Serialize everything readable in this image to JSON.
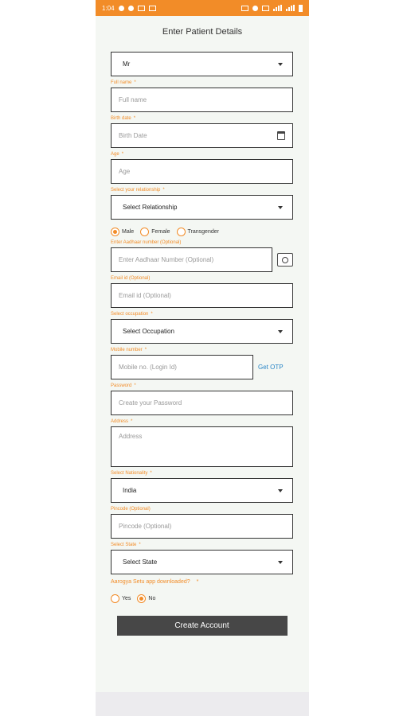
{
  "status_bar": {
    "time": "1:04"
  },
  "header": {
    "title": "Enter Patient Details"
  },
  "form": {
    "salutation": {
      "value": "Mr"
    },
    "full_name": {
      "label": "Full name",
      "placeholder": "Full name"
    },
    "birth_date": {
      "label": "Birth date",
      "placeholder": "Birth Date"
    },
    "age": {
      "label": "Age",
      "placeholder": "Age"
    },
    "relationship": {
      "label": "Select your relationship",
      "value": "Select Relationship"
    },
    "gender": {
      "options": [
        "Male",
        "Female",
        "Transgender"
      ],
      "selected": "Male"
    },
    "aadhaar": {
      "label": "Enter Aadhaar number (Optional)",
      "placeholder": "Enter Aadhaar Number (Optional)"
    },
    "email": {
      "label": "Email id (Optional)",
      "placeholder": "Email id (Optional)"
    },
    "occupation": {
      "label": "Select occupation",
      "value": "Select Occupation"
    },
    "mobile": {
      "label": "Mobile number",
      "placeholder": "Mobile no. (Login Id)",
      "otp_label": "Get OTP"
    },
    "password": {
      "label": "Password",
      "placeholder": "Create your Password"
    },
    "address": {
      "label": "Address",
      "placeholder": "Address"
    },
    "nationality": {
      "label": "Select Nationality",
      "value": "India"
    },
    "pincode": {
      "label": "Pincode (Optional)",
      "placeholder": "Pincode (Optional)"
    },
    "state": {
      "label": "Select State",
      "value": "Select State"
    },
    "aarogya": {
      "question": "Aarogya Setu app downloaded?",
      "options": [
        "Yes",
        "No"
      ],
      "selected": "No"
    },
    "required_mark": "*"
  },
  "submit": {
    "label": "Create Account"
  },
  "colors": {
    "accent": "#f28c28",
    "button": "#474747",
    "link": "#2a86c7"
  }
}
